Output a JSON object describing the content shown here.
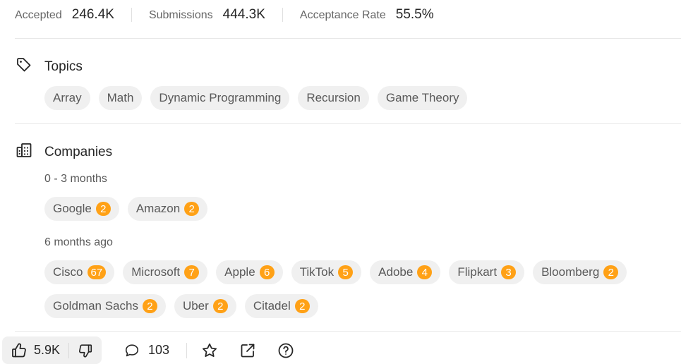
{
  "stats": {
    "accepted_label": "Accepted",
    "accepted_value": "246.4K",
    "submissions_label": "Submissions",
    "submissions_value": "444.3K",
    "rate_label": "Acceptance Rate",
    "rate_value": "55.5%"
  },
  "topics": {
    "title": "Topics",
    "icon": "tag-icon",
    "items": [
      "Array",
      "Math",
      "Dynamic Programming",
      "Recursion",
      "Game Theory"
    ]
  },
  "companies": {
    "title": "Companies",
    "icon": "building-icon",
    "groups": [
      {
        "period": "0 - 3 months",
        "items": [
          {
            "name": "Google",
            "count": "2"
          },
          {
            "name": "Amazon",
            "count": "2"
          }
        ]
      },
      {
        "period": "6 months ago",
        "items": [
          {
            "name": "Cisco",
            "count": "67"
          },
          {
            "name": "Microsoft",
            "count": "7"
          },
          {
            "name": "Apple",
            "count": "6"
          },
          {
            "name": "TikTok",
            "count": "5"
          },
          {
            "name": "Adobe",
            "count": "4"
          },
          {
            "name": "Flipkart",
            "count": "3"
          },
          {
            "name": "Bloomberg",
            "count": "2"
          },
          {
            "name": "Goldman Sachs",
            "count": "2"
          },
          {
            "name": "Uber",
            "count": "2"
          },
          {
            "name": "Citadel",
            "count": "2"
          }
        ]
      }
    ]
  },
  "actions": {
    "likes": "5.9K",
    "comments": "103",
    "icons": [
      "thumbs-up-icon",
      "thumbs-down-icon",
      "comment-icon",
      "star-icon",
      "share-icon",
      "help-icon"
    ]
  },
  "colors": {
    "badge": "#ffa116",
    "chip_bg": "#f0f0f0",
    "text": "#262626",
    "muted": "#595959"
  }
}
